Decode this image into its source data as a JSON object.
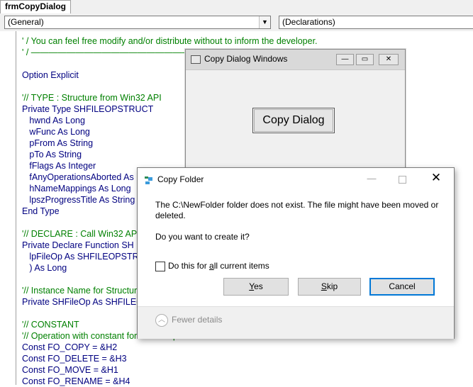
{
  "ide": {
    "tab_title": "frmCopyDialog",
    "object_combo": "(General)",
    "proc_combo": "(Declarations)",
    "combo_arrow": "▼"
  },
  "code_lines": [
    {
      "text": "' / You can feel free modify and/or distribute without to inform the developer.",
      "kind": "comment"
    },
    {
      "text": "' / ———————————————————————————",
      "kind": "comment"
    },
    {
      "text": "",
      "kind": "ident"
    },
    {
      "text": "Option Explicit",
      "kind": "ident"
    },
    {
      "text": "",
      "kind": "ident"
    },
    {
      "text": "'// TYPE : Structure from Win32 API",
      "kind": "comment"
    },
    {
      "text": "Private Type SHFILEOPSTRUCT",
      "kind": "ident"
    },
    {
      "text": "   hwnd As Long",
      "kind": "ident"
    },
    {
      "text": "   wFunc As Long",
      "kind": "ident"
    },
    {
      "text": "   pFrom As String",
      "kind": "ident"
    },
    {
      "text": "   pTo As String",
      "kind": "ident"
    },
    {
      "text": "   fFlags As Integer",
      "kind": "ident"
    },
    {
      "text": "   fAnyOperationsAborted As",
      "kind": "ident"
    },
    {
      "text": "   hNameMappings As Long",
      "kind": "ident"
    },
    {
      "text": "   lpszProgressTitle As String",
      "kind": "ident"
    },
    {
      "text": "End Type",
      "kind": "ident"
    },
    {
      "text": "",
      "kind": "ident"
    },
    {
      "text": "'// DECLARE : Call Win32 API",
      "kind": "comment"
    },
    {
      "text": "Private Declare Function SH",
      "kind": "ident"
    },
    {
      "text": "   lpFileOp As SHFILEOPSTRUCT",
      "kind": "ident"
    },
    {
      "text": "   ) As Long",
      "kind": "ident"
    },
    {
      "text": "",
      "kind": "ident"
    },
    {
      "text": "'// Instance Name for Structure",
      "kind": "comment"
    },
    {
      "text": "Private SHFileOp As SHFILEOPSTRUCT",
      "kind": "ident"
    },
    {
      "text": "",
      "kind": "ident"
    },
    {
      "text": "'// CONSTANT",
      "kind": "comment"
    },
    {
      "text": "'// Operation with constant for SHFileOperation",
      "kind": "comment"
    },
    {
      "text": "Const FO_COPY = &H2",
      "kind": "ident"
    },
    {
      "text": "Const FO_DELETE = &H3",
      "kind": "ident"
    },
    {
      "text": "Const FO_MOVE = &H1",
      "kind": "ident"
    },
    {
      "text": "Const FO_RENAME = &H4",
      "kind": "ident"
    }
  ],
  "vb_form": {
    "title": "Copy Dialog Windows",
    "min_glyph": "—",
    "max_glyph": "▭",
    "close_glyph": "✕",
    "button_label": "Copy Dialog"
  },
  "copy_dialog": {
    "title": "Copy Folder",
    "min_glyph": "—",
    "close_glyph": "✕",
    "message": "The C:\\NewFolder folder does not exist. The file might have been moved or deleted.",
    "question": "Do you want to create it?",
    "checkbox_label_pre": "Do this for ",
    "checkbox_label_accel": "a",
    "checkbox_label_post": "ll current items",
    "yes_accel": "Y",
    "yes_rest": "es",
    "skip_accel": "S",
    "skip_rest": "kip",
    "cancel_label": "Cancel",
    "fewer_glyph": "︿",
    "fewer_label": "Fewer details"
  }
}
